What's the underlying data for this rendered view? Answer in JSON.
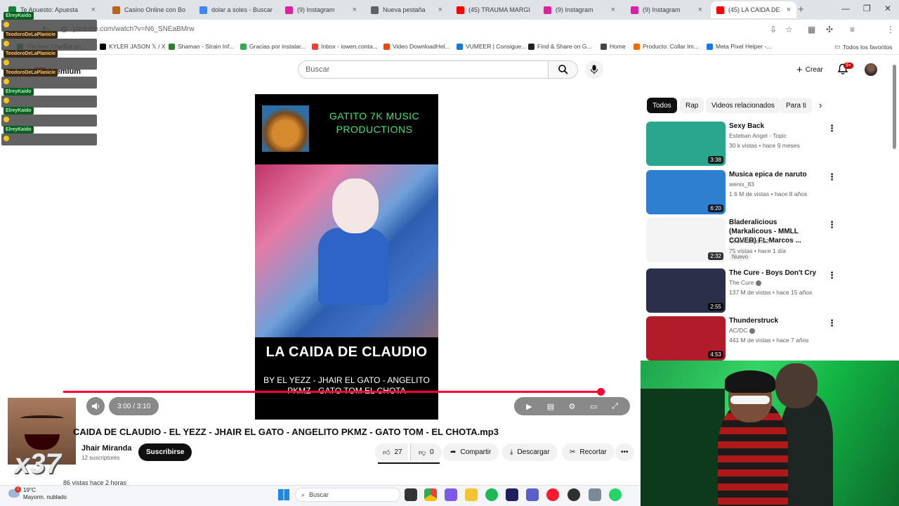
{
  "browser": {
    "tabs": [
      {
        "label": "Te Apuesto: Apuesta",
        "color": "#1c7e3c"
      },
      {
        "label": "Casino Online con Bo",
        "color": "#b5651d"
      },
      {
        "label": "dolar a soles - Buscar",
        "color": "#4285f4"
      },
      {
        "label": "(9) Instagram",
        "color": "#d6249f"
      },
      {
        "label": "Nueva pestaña",
        "color": "#5f6368"
      },
      {
        "label": "(45) TRAUMA MARGI",
        "color": "#ff0000"
      },
      {
        "label": "(9) Instagram",
        "color": "#d6249f"
      },
      {
        "label": "(9) Instagram",
        "color": "#d6249f"
      },
      {
        "label": "(45) LA CAIDA DE",
        "color": "#ff0000"
      }
    ],
    "url": "youtube.com/watch?v=N6_SNEaBMrw",
    "bookmarks": [
      {
        "label": "The best ChatBot an...",
        "color": "#10a37f"
      },
      {
        "label": "KYLER JASON 𝕏 / X",
        "color": "#000000"
      },
      {
        "label": "Shaman - Strain Inf...",
        "color": "#2e7d32"
      },
      {
        "label": "Gracias por instalar...",
        "color": "#34a853"
      },
      {
        "label": "Inbox - iowen.conta...",
        "color": "#ea4335"
      },
      {
        "label": "Video DownloadHel...",
        "color": "#e64a19"
      },
      {
        "label": "VUMEER | Consigue...",
        "color": "#1976d2"
      },
      {
        "label": "Find & Share on G...",
        "color": "#222222"
      },
      {
        "label": "Home",
        "color": "#444444"
      },
      {
        "label": "Producto: Collar Im...",
        "color": "#ef6c00"
      },
      {
        "label": "Meta Pixel Helper -...",
        "color": "#1877f2"
      }
    ],
    "favorites_label": "Todos los favoritos"
  },
  "chat": [
    {
      "name": "ElreyKaido",
      "msg": "",
      "style": "green"
    },
    {
      "name": "TeodoroDeLaPlanicie",
      "msg": "",
      "style": "orange"
    },
    {
      "name": "TeodoroDeLaPlanicie",
      "msg": "",
      "style": "orange"
    },
    {
      "name": "TeodoroDeLaPlanicie",
      "msg": "",
      "style": "orange"
    },
    {
      "name": "ElreyKaido",
      "msg": "",
      "style": "green"
    },
    {
      "name": "ElreyKaido",
      "msg": "",
      "style": "green"
    },
    {
      "name": "ElreyKaido",
      "msg": "",
      "style": "green"
    }
  ],
  "youtube": {
    "logo_text": "Premium",
    "search_placeholder": "Buscar",
    "create_label": "Crear",
    "notif_count": "9+",
    "video": {
      "header": "GATITO 7K MUSIC PRODUCTIONS",
      "big_title": "LA CAIDA DE CLAUDIO",
      "credits": "BY EL YEZZ - JHAIR EL GATO - ANGELITO PKMZ - GATO TOM EL CHOTA",
      "time": "3:00 / 3:10",
      "progress": 0.947
    },
    "meme_count": "x37",
    "title": "CAIDA DE CLAUDIO - EL YEZZ - JHAIR EL GATO - ANGELITO PKMZ - GATO TOM - EL CHOTA.mp3",
    "channel": "Jhair Miranda",
    "subscribers": "12 suscriptores",
    "subscribe_label": "Suscribirse",
    "likes": "27",
    "dislikes": "0",
    "share_label": "Compartir",
    "download_label": "Descargar",
    "clip_label": "Recortar",
    "views_line": "86 vistas  hace 2 horas",
    "chips": [
      "Todos",
      "Rap",
      "Videos relacionados",
      "Para ti"
    ],
    "recommendations": [
      {
        "title": "Sexy Back",
        "channel": "Esteban Angel - Topic",
        "stats": "30 k vistas • hace 9 meses",
        "duration": "3:38",
        "verified": false,
        "new": false,
        "thumb": "#2aa58e"
      },
      {
        "title": "Musica epica de naruto",
        "channel": "wenix_83",
        "stats": "1.6 M de vistas • hace 8 años",
        "duration": "6:20",
        "verified": false,
        "new": false,
        "thumb": "#2f7fd0"
      },
      {
        "title": "Bladeralicious (Markalicous - MMLL COVER) Ft. Marcos ...",
        "channel": "Cooler Neon52",
        "stats": "75 vistas • hace 1 día",
        "duration": "2:32",
        "verified": false,
        "new": true,
        "new_label": "Nuevo",
        "thumb": "#f4f4f4"
      },
      {
        "title": "The Cure - Boys Don't Cry",
        "channel": "The Cure",
        "stats": "137 M de vistas • hace 15 años",
        "duration": "2:55",
        "verified": true,
        "new": false,
        "thumb": "#2b2f4a"
      },
      {
        "title": "Thunderstruck",
        "channel": "AC/DC",
        "stats": "441 M de vistas • hace 7 años",
        "duration": "4:53",
        "verified": true,
        "new": false,
        "thumb": "#b21c2a"
      }
    ]
  },
  "taskbar": {
    "temp": "19°C",
    "weather": "Mayorm. nublado",
    "badge": "1",
    "search_label": "Buscar"
  }
}
